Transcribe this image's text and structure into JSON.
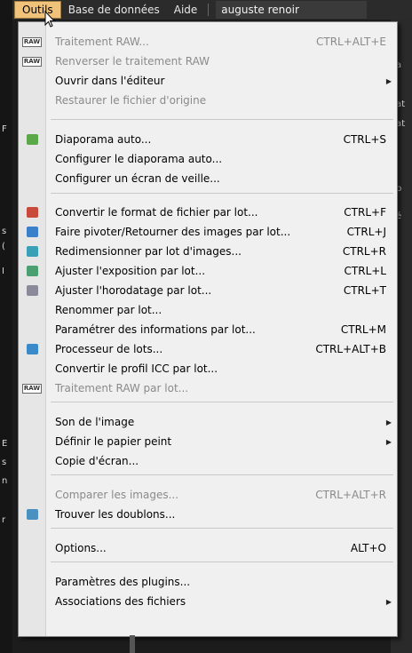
{
  "menubar": {
    "outils": "Outils",
    "base": "Base de données",
    "aide": "Aide",
    "search_value": "auguste renoir"
  },
  "background": {
    "right_frags": [
      "a",
      "at",
      "at",
      "p",
      "é"
    ],
    "left_frags": [
      "F",
      "s",
      "(",
      "I",
      "E",
      "s",
      "n",
      "r"
    ]
  },
  "menu": {
    "items": [
      {
        "label": "Traitement RAW...",
        "shortcut": "CTRL+ALT+E",
        "disabled": true,
        "icon": "raw-icon",
        "submenu": false
      },
      {
        "label": "Renverser le traitement RAW",
        "shortcut": "",
        "disabled": true,
        "icon": "raw-revert-icon",
        "submenu": false
      },
      {
        "label": "Ouvrir dans l'éditeur",
        "shortcut": "",
        "disabled": false,
        "icon": "",
        "submenu": true
      },
      {
        "label": "Restaurer le fichier d'origine",
        "shortcut": "",
        "disabled": true,
        "icon": "",
        "submenu": false
      },
      {
        "label": "Diaporama auto...",
        "shortcut": "CTRL+S",
        "disabled": false,
        "icon": "slideshow-icon",
        "submenu": false
      },
      {
        "label": "Configurer le diaporama auto...",
        "shortcut": "",
        "disabled": false,
        "icon": "",
        "submenu": false
      },
      {
        "label": "Configurer un écran de veille...",
        "shortcut": "",
        "disabled": false,
        "icon": "",
        "submenu": false
      },
      {
        "label": "Convertir le format de fichier par lot...",
        "shortcut": "CTRL+F",
        "disabled": false,
        "icon": "convert-icon",
        "submenu": false
      },
      {
        "label": "Faire pivoter/Retourner des images par lot...",
        "shortcut": "CTRL+J",
        "disabled": false,
        "icon": "rotate-icon",
        "submenu": false
      },
      {
        "label": "Redimensionner par lot d'images...",
        "shortcut": "CTRL+R",
        "disabled": false,
        "icon": "resize-icon",
        "submenu": false
      },
      {
        "label": "Ajuster l'exposition par lot...",
        "shortcut": "CTRL+L",
        "disabled": false,
        "icon": "exposure-icon",
        "submenu": false
      },
      {
        "label": "Ajuster l'horodatage par lot...",
        "shortcut": "CTRL+T",
        "disabled": false,
        "icon": "timestamp-icon",
        "submenu": false
      },
      {
        "label": "Renommer par lot...",
        "shortcut": "",
        "disabled": false,
        "icon": "",
        "submenu": false
      },
      {
        "label": "Paramétrer des informations par lot...",
        "shortcut": "CTRL+M",
        "disabled": false,
        "icon": "",
        "submenu": false
      },
      {
        "label": "Processeur de lots...",
        "shortcut": "CTRL+ALT+B",
        "disabled": false,
        "icon": "batch-processor-icon",
        "submenu": false
      },
      {
        "label": "Convertir le profil ICC par lot...",
        "shortcut": "",
        "disabled": false,
        "icon": "",
        "submenu": false
      },
      {
        "label": "Traitement RAW par lot...",
        "shortcut": "",
        "disabled": true,
        "icon": "raw-batch-icon",
        "submenu": false
      },
      {
        "label": "Son de l'image",
        "shortcut": "",
        "disabled": false,
        "icon": "",
        "submenu": true
      },
      {
        "label": "Définir le papier peint",
        "shortcut": "",
        "disabled": false,
        "icon": "",
        "submenu": true
      },
      {
        "label": "Copie d'écran...",
        "shortcut": "",
        "disabled": false,
        "icon": "",
        "submenu": false
      },
      {
        "label": "Comparer les images...",
        "shortcut": "CTRL+ALT+R",
        "disabled": true,
        "icon": "",
        "submenu": false
      },
      {
        "label": "Trouver les doublons...",
        "shortcut": "",
        "disabled": false,
        "icon": "duplicates-icon",
        "submenu": false
      },
      {
        "label": "Options...",
        "shortcut": "ALT+O",
        "disabled": false,
        "icon": "",
        "submenu": false
      },
      {
        "label": "Paramètres des plugins...",
        "shortcut": "",
        "disabled": false,
        "icon": "",
        "submenu": false
      },
      {
        "label": "Associations des fichiers",
        "shortcut": "",
        "disabled": false,
        "icon": "",
        "submenu": true
      }
    ]
  },
  "colors": {
    "menubar_bg": "#2b2b2b",
    "open_menu_bg": "#f1c27a",
    "dropdown_bg": "#f0f0f0",
    "disabled_text": "#8a8a8a"
  }
}
